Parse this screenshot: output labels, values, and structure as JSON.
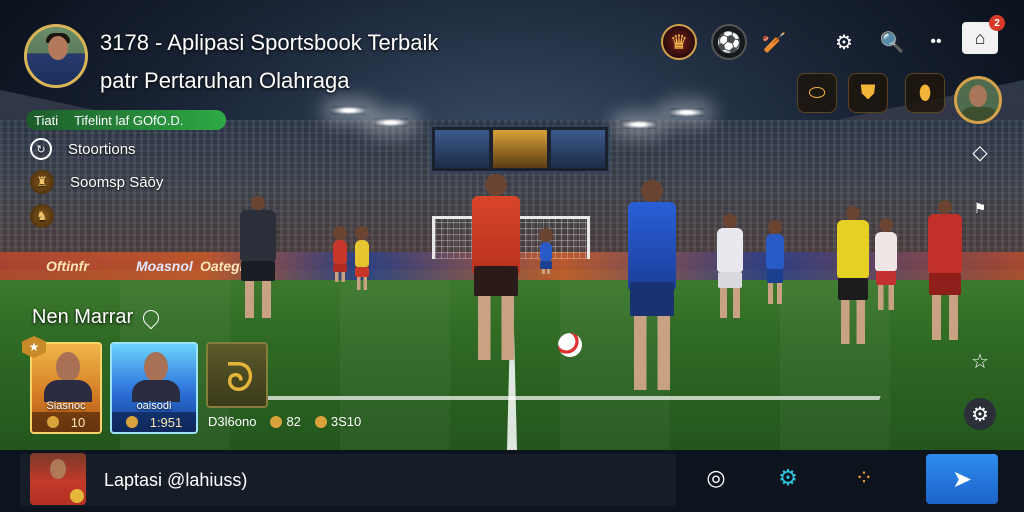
{
  "header": {
    "title_line1": "3178 - Aplipasi Sportsbook Terbaik",
    "title_line2": "patr Pertaruhan Olahraga",
    "status_label": "Tiati",
    "status_value": "Tifelint laf GOfO.D."
  },
  "menu": [
    {
      "icon": "refresh-icon",
      "label": "Stoortions"
    },
    {
      "icon": "trophy-icon",
      "label": "Soomsp Sāōy"
    },
    {
      "icon": "shield-icon",
      "label": ""
    }
  ],
  "top_icons": [
    "trophy-icon",
    "football-emblem-icon",
    "cricket-icon",
    "settings-icon",
    "search-icon",
    "more-icon",
    "notification-icon"
  ],
  "notification_count": "2",
  "ad_boards": [
    "Oftinfr",
    "Moasnol",
    "Oateglit"
  ],
  "market": {
    "title": "Nen Marrar",
    "cards": [
      {
        "name": "Siasnoc",
        "value": "10",
        "style": "gold"
      },
      {
        "name": "oaisodi",
        "value": "1:951",
        "style": "blue"
      },
      {
        "name": "",
        "value": "",
        "style": "olive"
      }
    ],
    "stats": [
      {
        "label": "D3l6ono"
      },
      {
        "label": "82"
      },
      {
        "label": "3S10"
      }
    ]
  },
  "bottom_bar": {
    "text": "Laptasi  @lahiuss)",
    "icons": [
      "share-icon",
      "gear-icon",
      "dots-icon"
    ],
    "send_label": "send"
  },
  "colors": {
    "accent": "#2e8cf0",
    "status_green": "#2eaa45",
    "gold": "#d3a24a"
  }
}
